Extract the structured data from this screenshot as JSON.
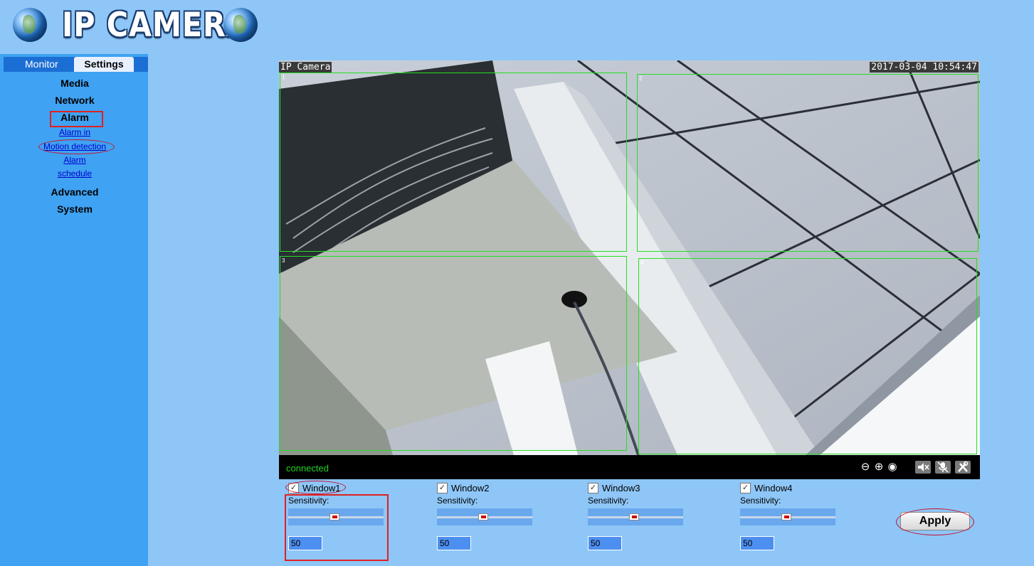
{
  "header": {
    "title": "IP CAMERA"
  },
  "nav": {
    "tabs": [
      {
        "label": "Monitor"
      },
      {
        "label": "Settings"
      }
    ],
    "menu": {
      "media": "Media",
      "network": "Network",
      "alarm": "Alarm",
      "alarm_sub": [
        "Alarm in",
        "Motion detection",
        "Alarm",
        "schedule"
      ],
      "advanced": "Advanced",
      "system": "System"
    }
  },
  "video": {
    "osd_name": "IP Camera",
    "osd_time": "2017-03-04 10:54:47",
    "status": "connected",
    "window_numbers": [
      "1",
      "2",
      "3",
      "4"
    ],
    "controls": [
      "zoom-out-icon",
      "zoom-in-icon",
      "record-icon",
      "mute-icon",
      "mic-off-icon",
      "settings-tools-icon"
    ]
  },
  "motion_windows": [
    {
      "label": "Window1",
      "checked": true,
      "sensitivity_label": "Sensitivity:",
      "value": "50"
    },
    {
      "label": "Window2",
      "checked": true,
      "sensitivity_label": "Sensitivity:",
      "value": "50"
    },
    {
      "label": "Window3",
      "checked": true,
      "sensitivity_label": "Sensitivity:",
      "value": "50"
    },
    {
      "label": "Window4",
      "checked": true,
      "sensitivity_label": "Sensitivity:",
      "value": "50"
    }
  ],
  "apply_label": "Apply",
  "colors": {
    "background": "#8ec6f7",
    "sidebar": "#3fa2f2",
    "status_green": "#23d423",
    "annotation_red": "#e02020"
  }
}
